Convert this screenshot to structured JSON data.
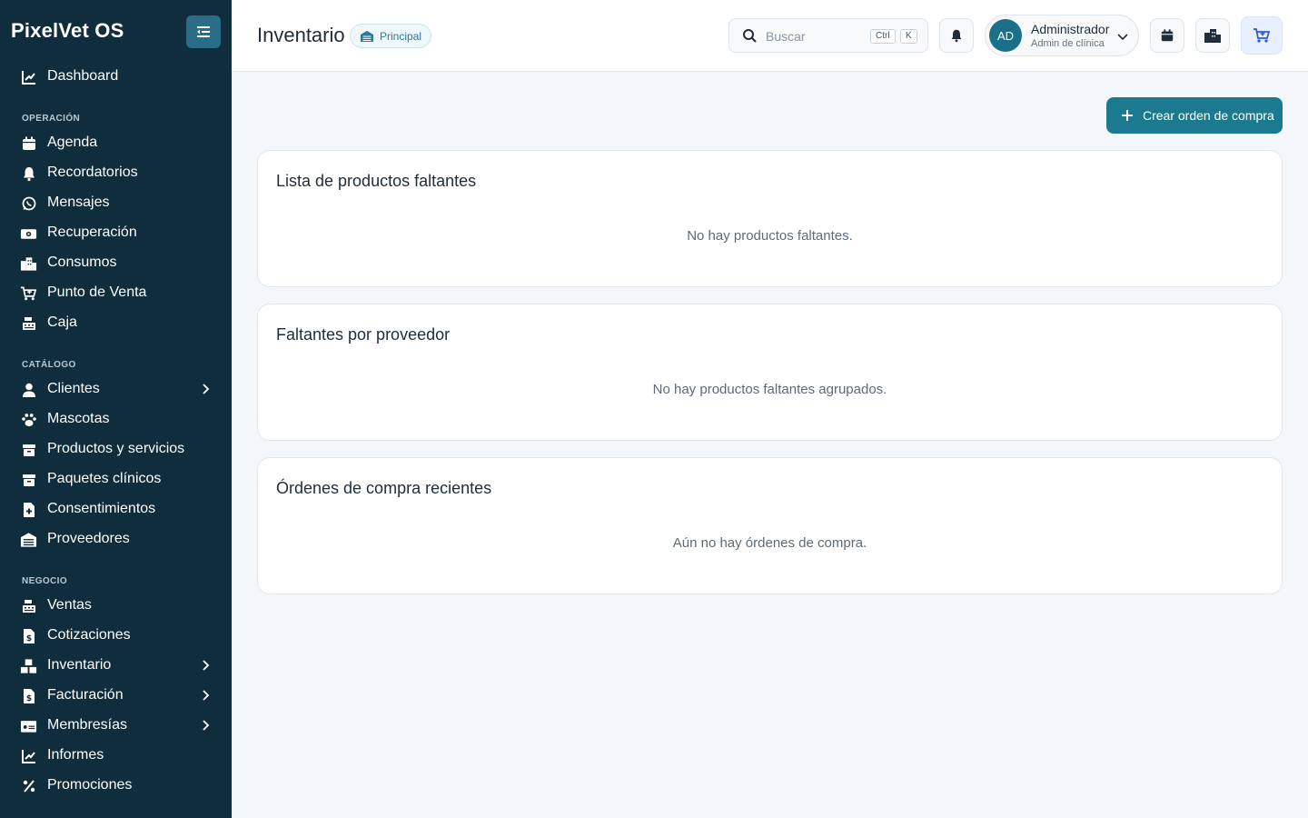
{
  "app": {
    "brand": "PixelVet OS"
  },
  "sidebar": {
    "dashboard": "Dashboard",
    "sections": {
      "operacion": "OPERACIÓN",
      "catalogo": "CATÁLOGO",
      "negocio": "NEGOCIO"
    },
    "items": {
      "agenda": "Agenda",
      "recordatorios": "Recordatorios",
      "mensajes": "Mensajes",
      "recuperacion": "Recuperación",
      "consumos": "Consumos",
      "punto_venta": "Punto de Venta",
      "caja": "Caja",
      "clientes": "Clientes",
      "mascotas": "Mascotas",
      "productos": "Productos y servicios",
      "paquetes": "Paquetes clínicos",
      "consentimientos": "Consentimientos",
      "proveedores": "Proveedores",
      "ventas": "Ventas",
      "cotizaciones": "Cotizaciones",
      "inventario": "Inventario",
      "facturacion": "Facturación",
      "membresias": "Membresías",
      "informes": "Informes",
      "promociones": "Promociones"
    }
  },
  "header": {
    "title": "Inventario",
    "branch": "Principal",
    "search_placeholder": "Buscar",
    "shortcut_ctrl": "Ctrl",
    "shortcut_key": "K",
    "user": {
      "initials": "AD",
      "name": "Administrador",
      "role": "Admin de clínica"
    }
  },
  "main": {
    "create_button": "Crear orden de compra",
    "cards": {
      "missing": {
        "title": "Lista de productos faltantes",
        "empty": "No hay productos faltantes."
      },
      "by_supplier": {
        "title": "Faltantes por proveedor",
        "empty": "No hay productos faltantes agrupados."
      },
      "orders": {
        "title": "Órdenes de compra recientes",
        "empty": "Aún no hay órdenes de compra."
      }
    }
  },
  "colors": {
    "sidebar_bg": "#0f2d3c",
    "accent": "#1b7a8f",
    "active_cart": "#2d5bd6"
  }
}
